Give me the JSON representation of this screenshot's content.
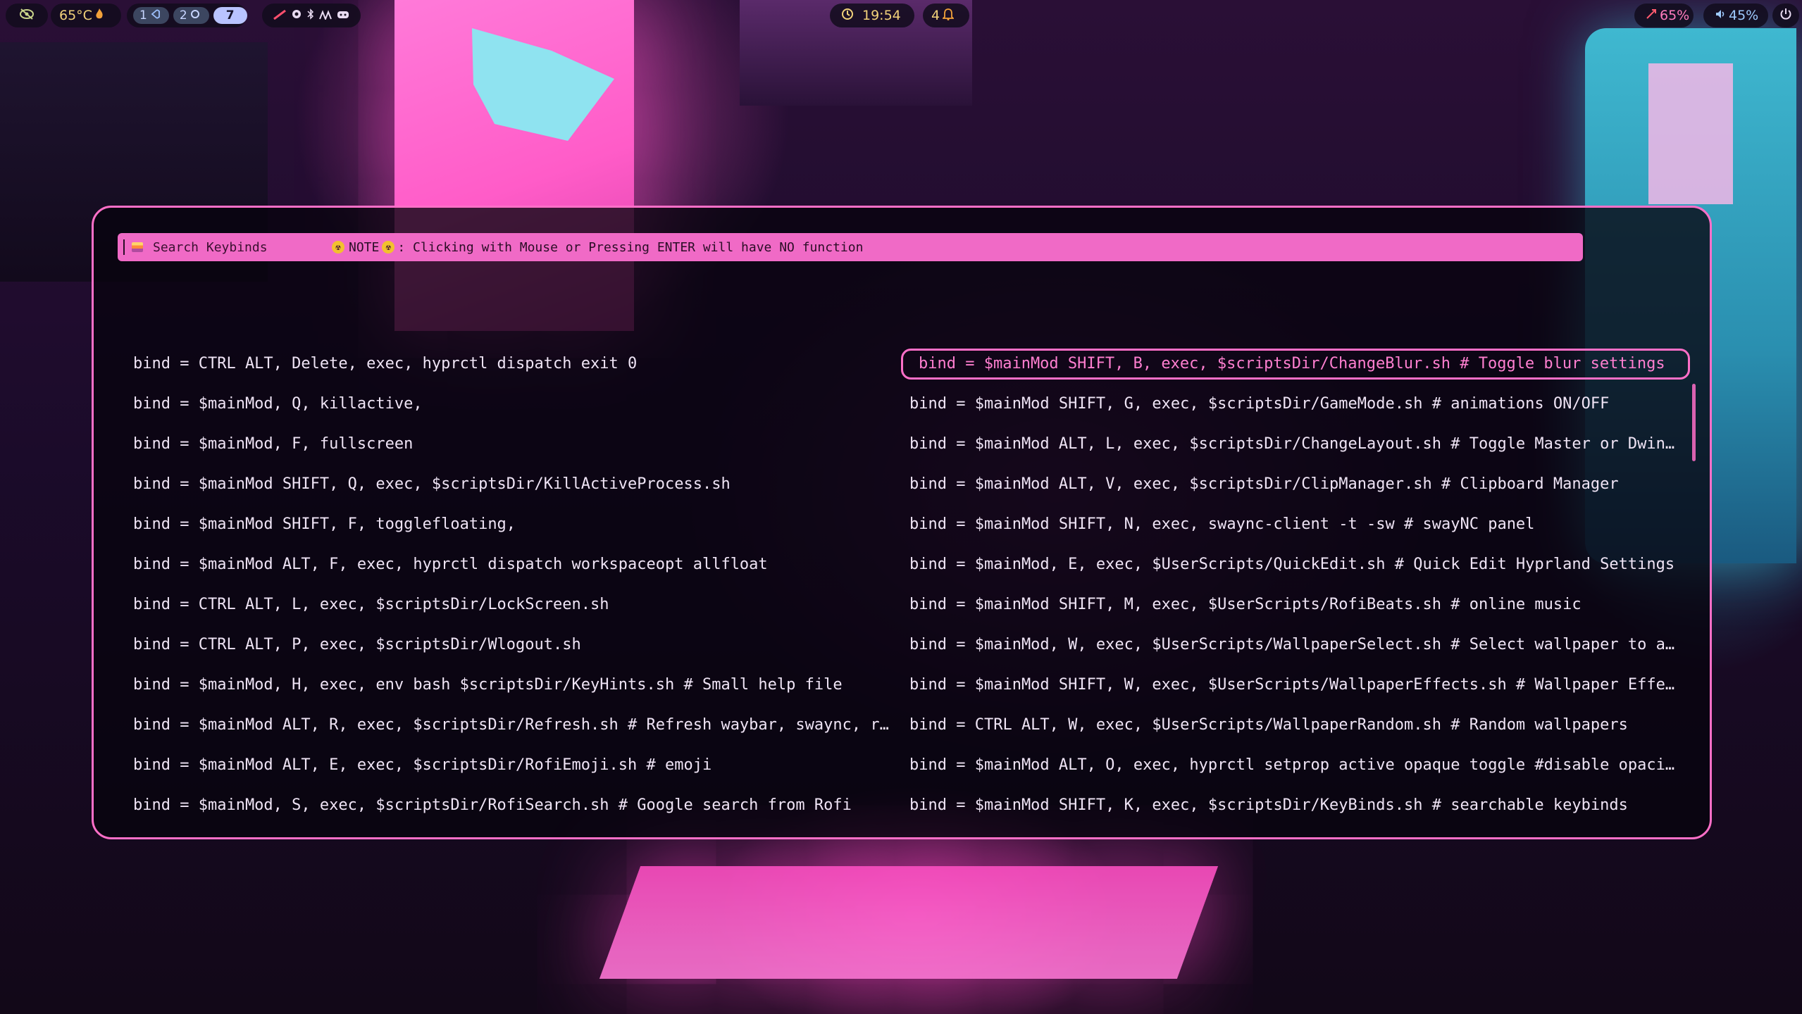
{
  "topbar": {
    "left": {
      "temperature": "65°C",
      "workspaces": [
        {
          "label": "1",
          "active": false
        },
        {
          "label": "2",
          "active": false
        },
        {
          "label": "7",
          "active": true
        }
      ]
    },
    "center": {
      "time": "19:54",
      "notification_count": "4"
    },
    "right": {
      "cpu": "65%",
      "volume": "45%"
    }
  },
  "rofi": {
    "search_placeholder": "Search Keybinds",
    "note_label": "NOTE",
    "note_text": ": Clicking with Mouse or Pressing ENTER will have NO function",
    "entries": [
      {
        "text": "bind = CTRL ALT, Delete, exec, hyprctl dispatch exit 0"
      },
      {
        "text": "bind = $mainMod SHIFT, B, exec, $scriptsDir/ChangeBlur.sh # Toggle blur settings"
      },
      {
        "text": "bind = $mainMod, Q, killactive,"
      },
      {
        "text": "bind = $mainMod SHIFT, G, exec, $scriptsDir/GameMode.sh # animations ON/OFF"
      },
      {
        "text": "bind = $mainMod, F, fullscreen"
      },
      {
        "text": "bind = $mainMod ALT, L, exec, $scriptsDir/ChangeLayout.sh # Toggle Master or Dwin…"
      },
      {
        "text": "bind = $mainMod SHIFT, Q, exec, $scriptsDir/KillActiveProcess.sh"
      },
      {
        "text": "bind = $mainMod ALT, V, exec, $scriptsDir/ClipManager.sh # Clipboard Manager"
      },
      {
        "text": "bind = $mainMod SHIFT, F, togglefloating,"
      },
      {
        "text": "bind = $mainMod SHIFT, N, exec, swaync-client -t -sw # swayNC panel"
      },
      {
        "text": "bind = $mainMod ALT, F, exec, hyprctl dispatch workspaceopt allfloat"
      },
      {
        "text": "bind = $mainMod, E, exec, $UserScripts/QuickEdit.sh # Quick Edit Hyprland Settings"
      },
      {
        "text": "bind = CTRL ALT, L, exec, $scriptsDir/LockScreen.sh"
      },
      {
        "text": "bind = $mainMod SHIFT, M, exec, $UserScripts/RofiBeats.sh # online music"
      },
      {
        "text": "bind = CTRL ALT, P, exec, $scriptsDir/Wlogout.sh"
      },
      {
        "text": "bind = $mainMod, W, exec, $UserScripts/WallpaperSelect.sh # Select wallpaper to a…"
      },
      {
        "text": "bind = $mainMod, H, exec, env bash $scriptsDir/KeyHints.sh # Small help file"
      },
      {
        "text": "bind = $mainMod SHIFT, W, exec, $UserScripts/WallpaperEffects.sh # Wallpaper Effe…"
      },
      {
        "text": "bind = $mainMod ALT, R, exec, $scriptsDir/Refresh.sh # Refresh waybar, swaync, ro…"
      },
      {
        "text": "bind = CTRL ALT, W, exec, $UserScripts/WallpaperRandom.sh # Random wallpapers"
      },
      {
        "text": "bind = $mainMod ALT, E, exec, $scriptsDir/RofiEmoji.sh # emoji"
      },
      {
        "text": "bind = $mainMod ALT, O, exec, hyprctl setprop active opaque toggle #disable opaci…"
      },
      {
        "text": "bind = $mainMod, S, exec, $scriptsDir/RofiSearch.sh # Google search from Rofi"
      },
      {
        "text": "bind = $mainMod SHIFT, K, exec, $scriptsDir/KeyBinds.sh # searchable keybinds"
      }
    ],
    "selected_index": 1
  },
  "colors": {
    "accent": "#ff6fc8",
    "inputbar": "#f06ac6",
    "selected_text": "#ff7fd0",
    "text": "#efe4f5",
    "bar_yellow": "#f2d27a"
  },
  "icons": [
    "eye-slash-icon",
    "flame-icon",
    "code-icon",
    "ubuntu-icon",
    "steam-icon",
    "chrome-icon",
    "bluetooth-icon",
    "discord-icon",
    "clock-icon",
    "bell-icon",
    "cpu-icon",
    "volume-icon",
    "power-icon",
    "warning-icon"
  ]
}
